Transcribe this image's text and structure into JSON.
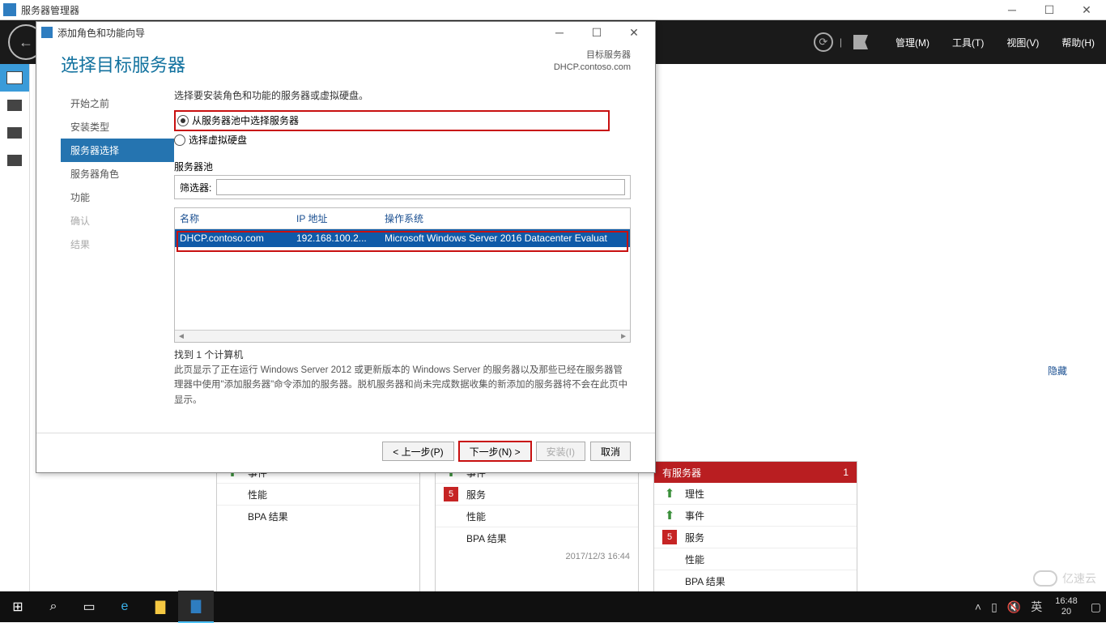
{
  "main": {
    "title": "服务器管理器",
    "menu": [
      "管理(M)",
      "工具(T)",
      "视图(V)",
      "帮助(H)"
    ],
    "hide": "隐藏"
  },
  "wizard": {
    "title": "添加角色和功能向导",
    "heading": "选择目标服务器",
    "dest_label": "目标服务器",
    "dest_value": "DHCP.contoso.com",
    "nav": {
      "before": "开始之前",
      "type": "安装类型",
      "select": "服务器选择",
      "roles": "服务器角色",
      "features": "功能",
      "confirm": "确认",
      "results": "结果"
    },
    "instruction": "选择要安装角色和功能的服务器或虚拟硬盘。",
    "radio_pool": "从服务器池中选择服务器",
    "radio_vhd": "选择虚拟硬盘",
    "pool_label": "服务器池",
    "filter_label": "筛选器:",
    "filter_value": "",
    "cols": {
      "name": "名称",
      "ip": "IP 地址",
      "os": "操作系统"
    },
    "row": {
      "name": "DHCP.contoso.com",
      "ip": "192.168.100.2...",
      "os": "Microsoft Windows Server 2016 Datacenter Evaluat"
    },
    "found": "找到 1 个计算机",
    "desc": "此页显示了正在运行 Windows Server 2012 或更新版本的 Windows Server 的服务器以及那些已经在服务器管理器中使用\"添加服务器\"命令添加的服务器。脱机服务器和尚未完成数据收集的新添加的服务器将不会在此页中显示。",
    "btn_prev": "< 上一步(P)",
    "btn_next": "下一步(N) >",
    "btn_install": "安装(I)",
    "btn_cancel": "取消"
  },
  "tiles": {
    "header_srv": "有服务器",
    "header_count": "1",
    "manage": "理性",
    "events": "事件",
    "services": "服务",
    "services_badge": "5",
    "perf": "性能",
    "bpa": "BPA 结果",
    "timestamp": "2017/12/3 16:44"
  },
  "taskbar": {
    "ime": "英",
    "time": "16:48",
    "date": "20"
  },
  "watermark": "亿速云"
}
